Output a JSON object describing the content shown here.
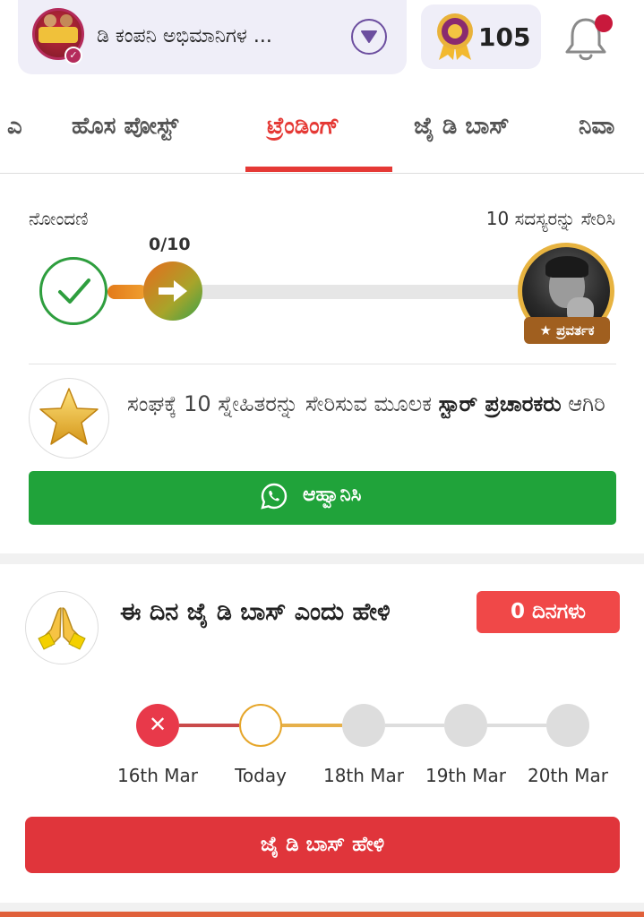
{
  "header": {
    "group_name": "ಡಿ ಕಂಪನಿ ಅಭಿಮಾನಿಗಳ ...",
    "points": "105",
    "icons": {
      "avatar": "group-avatar",
      "verified": "verified-badge-icon",
      "dropdown": "chevron-down-icon",
      "medal": "medal-icon",
      "bell": "bell-icon"
    },
    "colors": {
      "chip_bg": "#efeef8",
      "notification_dot": "#c8193c"
    }
  },
  "tabs": {
    "items": [
      {
        "label": "ಎ"
      },
      {
        "label": "ಹೊಸ ಪೋಸ್ಟ್"
      },
      {
        "label": "ಟ್ರೆಂಡಿಂಗ್",
        "active": true
      },
      {
        "label": "ಜೈ ಡಿ ಬಾಸ್"
      },
      {
        "label": "ನಿವಾ"
      }
    ],
    "active_color": "#e53935"
  },
  "referral": {
    "left_label": "ನೋಂದಣಿ",
    "right_label": "10 ಸದಸ್ಯರನ್ನು ಸೇರಿಸಿ",
    "progress_text": "0/10",
    "progress_value": 0,
    "progress_max": 10,
    "promoter_badge": "★ ಪ್ರವರ್ತಕ",
    "star_text_1": "ಸಂಘಕ್ಕೆ 10 ಸ್ನೇಹಿತರನ್ನು ಸೇರಿಸುವ ಮೂಲಕ ",
    "star_text_bold": "ಸ್ಟಾರ್ ಪ್ರಚಾರಕರು",
    "star_text_2": " ಆಗಿರಿ",
    "invite_button": "ಆಹ್ವಾನಿಸಿ",
    "icons": {
      "done": "check-icon",
      "current": "arrow-right-icon",
      "star": "star-icon",
      "invite": "whatsapp-icon"
    },
    "colors": {
      "invite_bg": "#20a33a",
      "done_ring": "#2e9e3e"
    }
  },
  "daily": {
    "title": "ಈ ದಿನ ಜೈ ಡಿ ಬಾಸ್ ಎಂದು ಹೇಳಿ",
    "days_badge": "0 ದಿನಗಳು",
    "days": [
      {
        "label": "16th Mar",
        "state": "missed"
      },
      {
        "label": "Today",
        "state": "today"
      },
      {
        "label": "18th Mar",
        "state": "future"
      },
      {
        "label": "19th Mar",
        "state": "future"
      },
      {
        "label": "20th Mar",
        "state": "future"
      }
    ],
    "missed_mark": "✕",
    "say_button": "ಜೈ ಡಿ ಬಾಸ್ ಹೇಳಿ",
    "icons": {
      "greeting": "folded-hands-icon"
    },
    "colors": {
      "badge_bg": "#f04848",
      "button_bg": "#e0353b",
      "missed": "#e8394a",
      "today_ring": "#e6a62a"
    }
  }
}
